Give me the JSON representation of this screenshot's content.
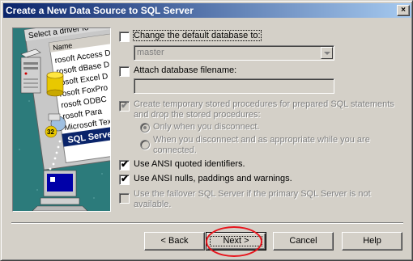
{
  "window": {
    "title": "Create a New Data Source to SQL Server",
    "close_glyph": "×"
  },
  "illustration": {
    "header_text": "Select a driver fo",
    "list_header": "Name",
    "items": [
      "rosoft Access D",
      "rosoft dBase D",
      "rosoft Excel D",
      "rosoft FoxPro",
      "rosoft ODBC",
      "rosoft Para",
      "Microsoft Tex"
    ],
    "selected_item": "SQL Server",
    "badge": "32"
  },
  "options": {
    "change_default_db": {
      "label": "Change the default database to:",
      "checked": false
    },
    "default_db_value": "master",
    "attach_db": {
      "label": "Attach database filename:",
      "checked": false
    },
    "attach_db_value": "",
    "create_temp_procs": {
      "label_line1": "Create temporary stored procedures for prepared SQL statements",
      "label_line2": "and drop the stored procedures:",
      "checked": true
    },
    "radio_disconnect": {
      "label": "Only when you disconnect.",
      "selected": true
    },
    "radio_when_appropriate": {
      "label_line1": "When you disconnect and as appropriate while you are",
      "label_line2": "connected.",
      "selected": false
    },
    "ansi_quoted": {
      "label": "Use ANSI quoted identifiers.",
      "checked": true
    },
    "ansi_nulls": {
      "label": "Use ANSI nulls, paddings and warnings.",
      "checked": true
    },
    "failover": {
      "label_line1": "Use the failover SQL Server if the primary SQL Server is not",
      "label_line2": "available.",
      "checked": false
    }
  },
  "buttons": {
    "back": "< Back",
    "next": "Next >",
    "cancel": "Cancel",
    "help": "Help"
  },
  "check_glyph": "✔"
}
